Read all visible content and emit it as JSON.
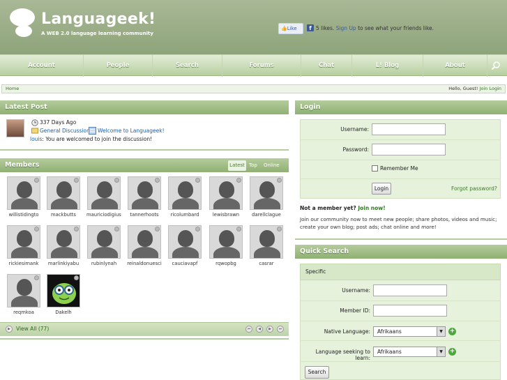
{
  "header": {
    "title": "Languageek!",
    "subtitle": "A WEB 2.0 language learning community",
    "fb_like_label": "Like",
    "fb_icon": "f",
    "fb_count_text": "5 likes.",
    "fb_signup_label": "Sign Up",
    "fb_rest_text": "to see what your friends like."
  },
  "nav": {
    "items": [
      "Account",
      "People",
      "Search",
      "Forums",
      "Chat",
      "L! Blog",
      "About"
    ]
  },
  "breadcrumb": {
    "home_label": "Home",
    "greeting": "Hello, Guest!",
    "login_label": "Join Login"
  },
  "latest_post": {
    "heading": "Latest Post",
    "age": "337 Days Ago",
    "forum": "General Discussion",
    "thread": "Welcome to Languageek!",
    "author": "louis",
    "message": ": You are welcomed to join the discussion!"
  },
  "members": {
    "heading": "Members",
    "tabs": [
      "Latest",
      "Top",
      "Online"
    ],
    "names": [
      "willistidingto",
      "mackbutts",
      "mauriciodigiuse",
      "tannerhoots",
      "ricolumbard",
      "lewisbrawn",
      "darellclague",
      "rickiesimank",
      "marlinkiyabu",
      "rubinlynah",
      "reinaldonuesci",
      "cauciavapf",
      "rqwopbg",
      "casrar",
      "reqmkoa",
      "Dakelh"
    ],
    "view_all": "View All (77)"
  },
  "login": {
    "heading": "Login",
    "username_label": "Username:",
    "password_label": "Password:",
    "remember_label": "Remember Me",
    "login_button": "Login",
    "forgot_label": "Forgot password?",
    "not_member": "Not a member yet?",
    "join_label": "Join now!",
    "pitch": "Join our community now to meet new people; share photos, videos and music; create your own blog; post ads; chat online and more!"
  },
  "quick_search": {
    "heading": "Quick Search",
    "section_label": "Specific",
    "username_label": "Username:",
    "member_id_label": "Member ID:",
    "native_label": "Native Language:",
    "native_value": "Afrikaans",
    "seeking_label": "Language seeking to learn:",
    "seeking_value": "Afrikaans",
    "search_button": "Search"
  }
}
